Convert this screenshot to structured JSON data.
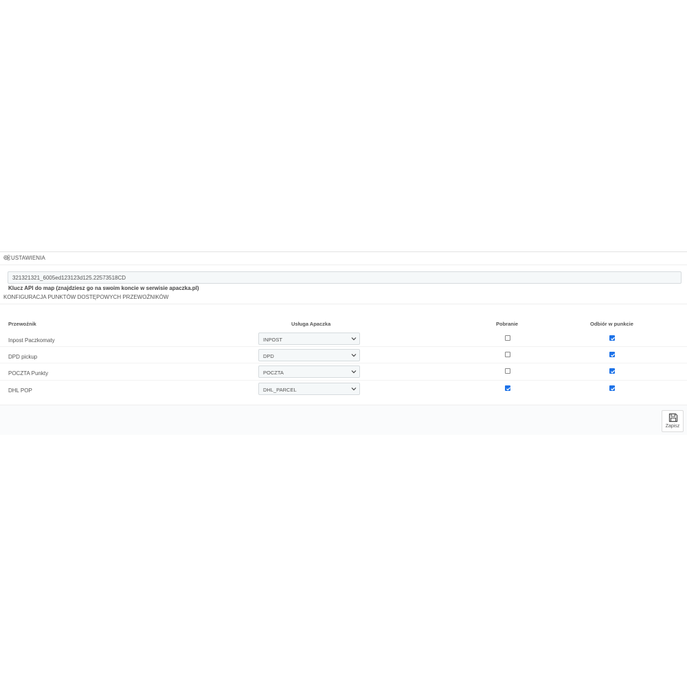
{
  "panel": {
    "heading": {
      "icon": "gears-icon",
      "title": "USTAWIENIA"
    },
    "api_key": {
      "value": "321321321_6005ed123123d125.22573518CD",
      "help": "Klucz API do map (znajdziesz go na swoim koncie w serwisie apaczka.pl)"
    },
    "section_title": "KONFIGURACJA PUNKTÓW DOSTĘPOWYCH PRZEWOŹNIKÓW",
    "table": {
      "headers": {
        "carrier": "Przewoźnik",
        "service": "Usługa Apaczka",
        "cod": "Pobranie",
        "pickup": "Odbiór w punkcie"
      },
      "rows": [
        {
          "carrier": "Inpost Paczkomaty",
          "service": "INPOST",
          "cod": false,
          "pickup": true
        },
        {
          "carrier": "DPD pickup",
          "service": "DPD",
          "cod": false,
          "pickup": true
        },
        {
          "carrier": "POCZTA Punkty",
          "service": "POCZTA",
          "cod": false,
          "pickup": true
        },
        {
          "carrier": "DHL POP",
          "service": "DHL_PARCEL",
          "cod": true,
          "pickup": true
        }
      ]
    },
    "footer": {
      "save_label": "Zapisz",
      "save_icon": "floppy-disk-icon"
    }
  },
  "colors": {
    "checkbox_checked": "#1e73e8",
    "input_bg": "#f5f8f9",
    "border": "#d6dbde"
  }
}
